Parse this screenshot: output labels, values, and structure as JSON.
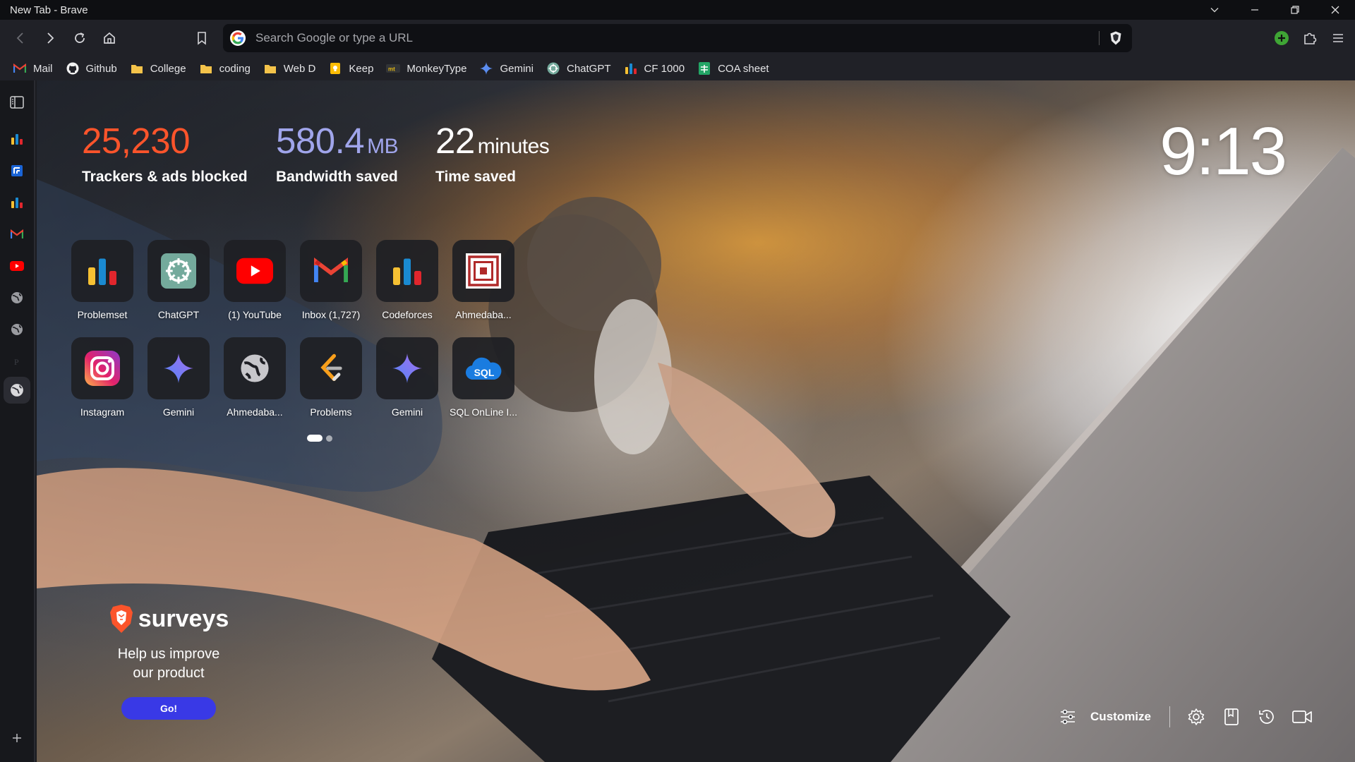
{
  "window": {
    "title": "New Tab - Brave"
  },
  "toolbar": {
    "search_placeholder": "Search Google or type a URL"
  },
  "bookmarks": [
    {
      "label": "Mail",
      "icon": "gmail-icon"
    },
    {
      "label": "Github",
      "icon": "github-icon"
    },
    {
      "label": "College",
      "icon": "folder-icon"
    },
    {
      "label": "coding",
      "icon": "folder-icon"
    },
    {
      "label": "Web D",
      "icon": "folder-icon"
    },
    {
      "label": "Keep",
      "icon": "keep-icon"
    },
    {
      "label": "MonkeyType",
      "icon": "monkeytype-icon"
    },
    {
      "label": "Gemini",
      "icon": "gemini-icon"
    },
    {
      "label": "ChatGPT",
      "icon": "chatgpt-icon"
    },
    {
      "label": "CF 1000",
      "icon": "codeforces-icon"
    },
    {
      "label": "COA sheet",
      "icon": "sheets-icon"
    }
  ],
  "stats": {
    "trackers": {
      "value": "25,230",
      "label": "Trackers & ads blocked",
      "color": "#fb542b"
    },
    "bandwidth": {
      "value": "580.4",
      "unit": "MB",
      "label": "Bandwidth saved",
      "color": "#a0a5eb"
    },
    "time": {
      "value": "22",
      "unit": "minutes",
      "label": "Time saved",
      "color": "#ffffff"
    }
  },
  "clock": "9:13",
  "top_sites": [
    {
      "name": "Problemset",
      "icon": "codeforces-icon"
    },
    {
      "name": "ChatGPT",
      "icon": "chatgpt-icon"
    },
    {
      "name": "(1) YouTube",
      "icon": "youtube-icon"
    },
    {
      "name": "Inbox (1,727)",
      "icon": "gmail-icon"
    },
    {
      "name": "Codeforces",
      "icon": "codeforces-icon"
    },
    {
      "name": "Ahmedaba...",
      "icon": "university-icon"
    },
    {
      "name": "Instagram",
      "icon": "instagram-icon"
    },
    {
      "name": "Gemini",
      "icon": "gemini-icon"
    },
    {
      "name": "Ahmedaba...",
      "icon": "globe-icon"
    },
    {
      "name": "Problems",
      "icon": "leetcode-icon"
    },
    {
      "name": "Gemini",
      "icon": "gemini-icon"
    },
    {
      "name": "SQL OnLine I...",
      "icon": "sql-icon"
    }
  ],
  "survey": {
    "brand": "surveys",
    "message_line1": "Help us improve",
    "message_line2": "our product",
    "button": "Go!"
  },
  "bottom": {
    "customize": "Customize"
  },
  "colors": {
    "accent": "#3939e6",
    "brave_orange": "#fb542b"
  }
}
